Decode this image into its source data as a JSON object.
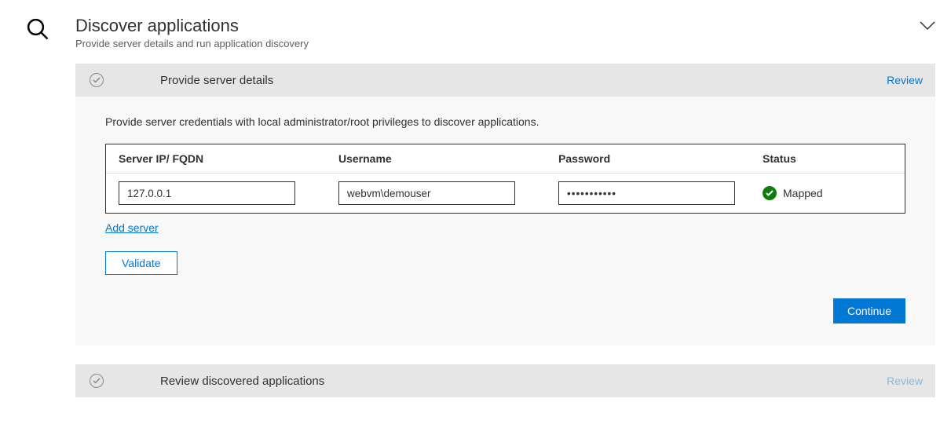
{
  "header": {
    "title": "Discover applications",
    "subtitle": "Provide server details and run application discovery"
  },
  "sections": {
    "provide": {
      "title": "Provide server details",
      "review_label": "Review",
      "instruction": "Provide server credentials with local administrator/root privileges to discover applications.",
      "columns": {
        "ip": "Server IP/ FQDN",
        "user": "Username",
        "pass": "Password",
        "status": "Status"
      },
      "rows": [
        {
          "ip": "127.0.0.1",
          "user": "webvm\\demouser",
          "pass": "•••••••••••",
          "status": "Mapped"
        }
      ],
      "add_server_label": "Add server",
      "validate_label": "Validate",
      "continue_label": "Continue"
    },
    "review": {
      "title": "Review discovered applications",
      "review_label": "Review"
    }
  }
}
